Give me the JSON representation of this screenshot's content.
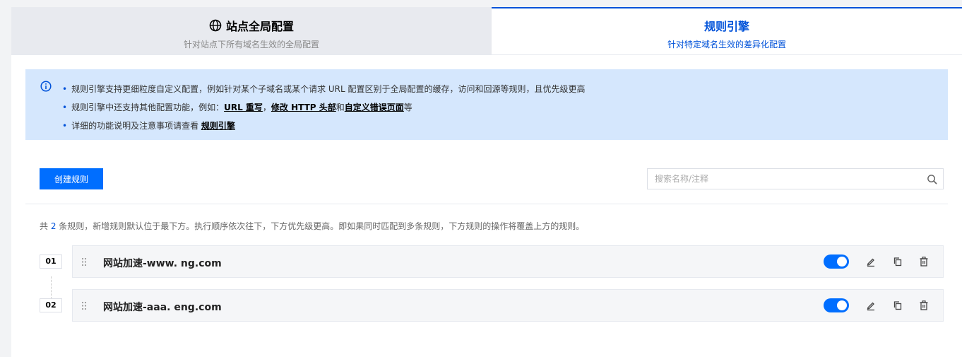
{
  "tabs": {
    "global": {
      "title": "站点全局配置",
      "subtitle": "针对站点下所有域名生效的全局配置"
    },
    "rules": {
      "title": "规则引擎",
      "subtitle": "针对特定域名生效的差异化配置"
    }
  },
  "info": {
    "line1": "规则引擎支持更细粒度自定义配置，例如针对某个子域名或某个请求 URL 配置区别于全局配置的缓存，访问和回源等规则，且优先级更高",
    "line2_prefix": "规则引擎中还支持其他配置功能，例如：",
    "link_url_rewrite": "URL 重写",
    "sep_comma": "，",
    "link_modify_header": "修改 HTTP 头部",
    "sep_and": "和",
    "link_custom_error": "自定义错误页面",
    "line2_suffix": "等",
    "line3_prefix": "详细的功能说明及注意事项请查看 ",
    "link_rule_engine": "规则引擎"
  },
  "toolbar": {
    "create_label": "创建规则",
    "search_placeholder": "搜索名称/注释"
  },
  "summary": {
    "prefix": "共 ",
    "count": "2",
    "suffix": " 条规则，新增规则默认位于最下方。执行顺序依次往下，下方优先级更高。即如果同时匹配到多条规则，下方规则的操作将覆盖上方的规则。"
  },
  "rules": [
    {
      "index": "01",
      "name": "网站加速-www.            ng.com",
      "enabled": true
    },
    {
      "index": "02",
      "name": "网站加速-aaa.            eng.com",
      "enabled": true
    }
  ],
  "colors": {
    "accent": "#0052d9",
    "button": "#006eff",
    "info_bg": "#d5e7fd"
  }
}
